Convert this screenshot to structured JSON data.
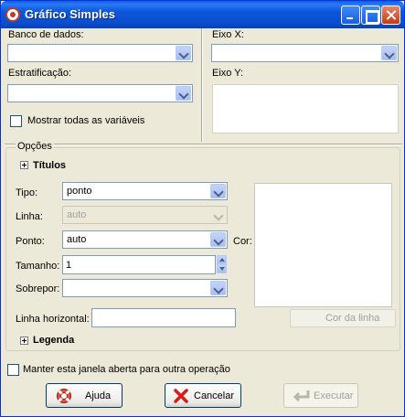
{
  "window": {
    "title": "Gráfico Simples",
    "title_icon": "r-logo-icon",
    "controls": [
      "minimize-icon",
      "maximize-icon",
      "close-icon"
    ]
  },
  "data_section": {
    "database_label": "Banco de dados:",
    "database_value": "",
    "stratification_label": "Estratificação:",
    "stratification_value": "",
    "show_all_label": "Mostrar todas as variáveis",
    "show_all_checked": false,
    "x_axis_label": "Eixo X:",
    "x_axis_value": "",
    "y_axis_label": "Eixo Y:"
  },
  "options": {
    "group_title": "Opções",
    "titles_label": "Títulos",
    "type_label": "Tipo:",
    "type_value": "ponto",
    "line_label": "Linha:",
    "line_value": "auto",
    "point_label": "Ponto:",
    "point_value": "auto",
    "color_label": "Cor:",
    "size_label": "Tamanho:",
    "size_value": "1",
    "overlay_label": "Sobrepor:",
    "overlay_value": "",
    "hline_label": "Linha horizontal:",
    "hline_value": "",
    "line_color_button": "Cor da linha",
    "legend_label": "Legenda"
  },
  "footer": {
    "keep_open_label": "Manter esta janela aberta para outra operação",
    "keep_open_checked": false,
    "help_button": "Ajuda",
    "help_icon": "lifebuoy-icon",
    "cancel_button": "Cancelar",
    "cancel_icon": "red-x-icon",
    "run_button": "Executar",
    "run_icon": "return-arrow-icon"
  },
  "colors": {
    "titlebar": "#0a4fd0",
    "window_bg": "#ece9d8",
    "field_border": "#7f9db9"
  }
}
